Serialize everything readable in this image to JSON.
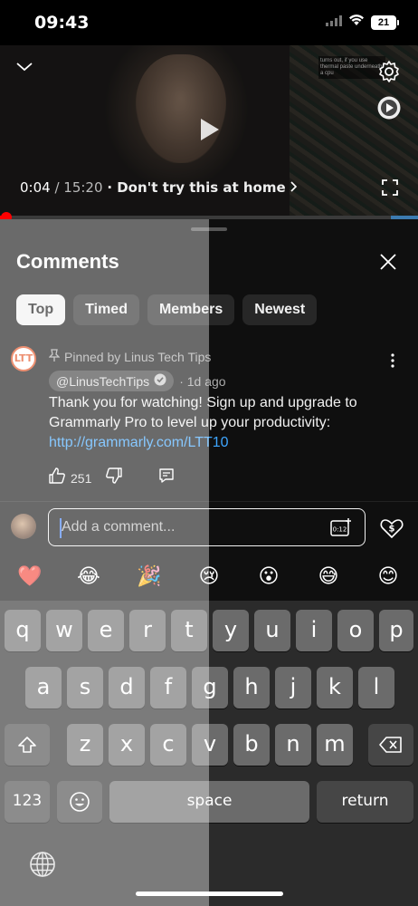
{
  "status_bar": {
    "time": "09:43",
    "battery": "21"
  },
  "video": {
    "current_time": "0:04",
    "duration": "/ 15:20",
    "chapter": "· Don't try this at home",
    "caption_text": "turns out, if you use thermal paste underneath a cpu",
    "progress_fraction": 0.015
  },
  "comments_sheet": {
    "title": "Comments",
    "chips": [
      "Top",
      "Timed",
      "Members",
      "Newest"
    ],
    "pinned_comment": {
      "avatar_text": "LTT",
      "pinned_label": "Pinned by Linus Tech Tips",
      "author": "@LinusTechTips",
      "age": "· 1d ago",
      "text": "Thank you for watching! Sign up and upgrade to Grammarly Pro to level up your productivity: ",
      "link": "http://grammarly.com/LTT10",
      "likes": "251"
    }
  },
  "composer": {
    "placeholder": "Add a comment..."
  },
  "emoji_bar": [
    "❤️",
    "😂",
    "🎉",
    "😢",
    "😮",
    "😅",
    "😊"
  ],
  "keyboard": {
    "row1": [
      "q",
      "w",
      "e",
      "r",
      "t",
      "y",
      "u",
      "i",
      "o",
      "p"
    ],
    "row2": [
      "a",
      "s",
      "d",
      "f",
      "g",
      "h",
      "j",
      "k",
      "l"
    ],
    "row3": [
      "z",
      "x",
      "c",
      "v",
      "b",
      "n",
      "m"
    ],
    "numbers_label": "123",
    "space_label": "space",
    "return_label": "return"
  }
}
